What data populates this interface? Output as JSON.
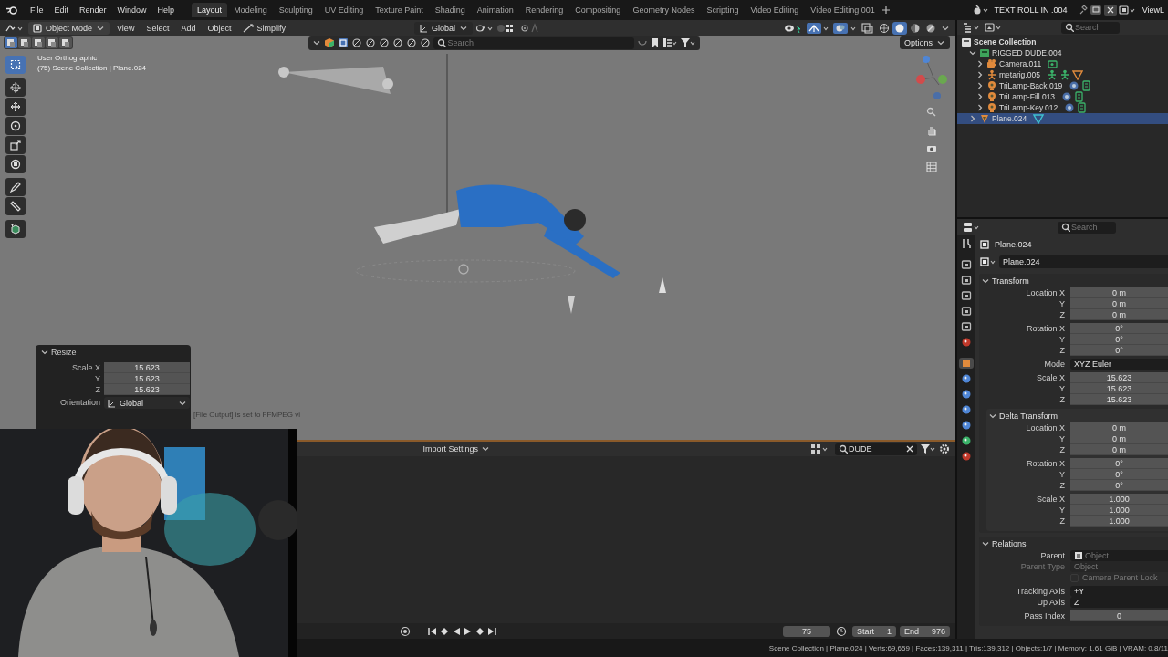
{
  "topbar": {
    "menus": [
      "File",
      "Edit",
      "Render",
      "Window",
      "Help"
    ],
    "workspaces": [
      {
        "label": "Layout",
        "selected": true
      },
      {
        "label": "Modeling",
        "selected": false
      },
      {
        "label": "Sculpting",
        "selected": false
      },
      {
        "label": "UV Editing",
        "selected": false
      },
      {
        "label": "Texture Paint",
        "selected": false
      },
      {
        "label": "Shading",
        "selected": false
      },
      {
        "label": "Animation",
        "selected": false
      },
      {
        "label": "Rendering",
        "selected": false
      },
      {
        "label": "Compositing",
        "selected": false
      },
      {
        "label": "Geometry Nodes",
        "selected": false
      },
      {
        "label": "Scripting",
        "selected": false
      },
      {
        "label": "Video Editing",
        "selected": false
      },
      {
        "label": "Video Editing.001",
        "selected": false
      }
    ],
    "scene": "TEXT ROLL IN .004",
    "view_layer": "ViewL"
  },
  "viewport": {
    "mode": "Object Mode",
    "menus": [
      "View",
      "Select",
      "Add",
      "Object"
    ],
    "simplify": "Simplify",
    "orientation": "Global",
    "search": {
      "placeholder": "Search"
    },
    "options": "Options",
    "select_modes": [
      {
        "selected": true
      },
      {
        "selected": false
      },
      {
        "selected": false
      },
      {
        "selected": false
      },
      {
        "selected": false
      }
    ],
    "shading": [
      {
        "selected": false
      },
      {
        "selected": true
      },
      {
        "selected": false
      },
      {
        "selected": false
      }
    ],
    "view_name": "User Orthographic",
    "view_info": "(75) Scene Collection | Plane.024",
    "tools": [
      {
        "selected": true
      },
      {
        "selected": false
      },
      {
        "selected": false
      },
      {
        "selected": false
      },
      {
        "selected": false
      },
      {
        "selected": false
      },
      {
        "selected": false
      },
      {
        "selected": false
      },
      {
        "selected": false
      }
    ],
    "info": "[File Output] is set to FFMPEG vi",
    "resize": {
      "title": "Resize",
      "expanded": true,
      "rows": [
        {
          "label": "Scale X",
          "value": "15.623"
        },
        {
          "label": "Y",
          "value": "15.623"
        },
        {
          "label": "Z",
          "value": "15.623"
        }
      ],
      "orientation_label": "Orientation",
      "orientation": "Global"
    }
  },
  "asset_browser": {
    "import_settings": "Import Settings",
    "filter": {
      "value": "DUDE"
    }
  },
  "timeline": {
    "frame": "75",
    "start_label": "Start",
    "start": "1",
    "end_label": "End",
    "end": "976"
  },
  "outliner": {
    "search": {
      "placeholder": "Search"
    },
    "tree": [
      {
        "label": "Scene Collection",
        "kind": "scene",
        "selected": false,
        "children": [
          {
            "label": "RIGGED DUDE.004",
            "kind": "collection",
            "expanded": true,
            "selected": false,
            "children": [
              {
                "label": "Camera.011",
                "kind": "camera",
                "expanded": false,
                "selected": false
              },
              {
                "label": "metarig.005",
                "kind": "armature",
                "expanded": false,
                "selected": false
              },
              {
                "label": "TriLamp-Back.019",
                "kind": "light",
                "expanded": false,
                "selected": false
              },
              {
                "label": "TriLamp-Fill.013",
                "kind": "light",
                "expanded": false,
                "selected": false
              },
              {
                "label": "TriLamp-Key.012",
                "kind": "light",
                "expanded": false,
                "selected": false
              }
            ]
          },
          {
            "label": "Plane.024",
            "kind": "mesh",
            "expanded": false,
            "selected": true
          }
        ]
      }
    ]
  },
  "properties": {
    "search": {
      "placeholder": "Search"
    },
    "tabs": [
      {
        "selected": false
      },
      {
        "selected": false
      },
      {
        "selected": false
      },
      {
        "selected": false
      },
      {
        "selected": false
      },
      {
        "selected": false
      },
      {
        "selected": true
      },
      {
        "selected": false
      },
      {
        "selected": false
      },
      {
        "selected": false
      },
      {
        "selected": false
      },
      {
        "selected": false
      },
      {
        "selected": false
      }
    ],
    "object": "Plane.024",
    "name": "Plane.024",
    "sections": [
      {
        "title": "Transform",
        "expanded": true,
        "groups": [
          [
            {
              "kind": "number",
              "label": "Location X",
              "value": "0 m",
              "disabled": false
            },
            {
              "kind": "number",
              "label": "Y",
              "value": "0 m",
              "disabled": false
            },
            {
              "kind": "number",
              "label": "Z",
              "value": "0 m",
              "disabled": false
            }
          ],
          [
            {
              "kind": "number",
              "label": "Rotation X",
              "value": "0°",
              "disabled": false
            },
            {
              "kind": "number",
              "label": "Y",
              "value": "0°",
              "disabled": false
            },
            {
              "kind": "number",
              "label": "Z",
              "value": "0°",
              "disabled": false
            }
          ],
          [
            {
              "kind": "dropdown",
              "label": "Mode",
              "value": "XYZ Euler",
              "disabled": false
            }
          ],
          [
            {
              "kind": "number",
              "label": "Scale X",
              "value": "15.623",
              "disabled": false
            },
            {
              "kind": "number",
              "label": "Y",
              "value": "15.623",
              "disabled": false
            },
            {
              "kind": "number",
              "label": "Z",
              "value": "15.623",
              "disabled": false
            }
          ]
        ],
        "children": [
          {
            "title": "Delta Transform",
            "expanded": true,
            "groups": [
              [
                {
                  "kind": "number",
                  "label": "Location X",
                  "value": "0 m",
                  "disabled": false
                },
                {
                  "kind": "number",
                  "label": "Y",
                  "value": "0 m",
                  "disabled": false
                },
                {
                  "kind": "number",
                  "label": "Z",
                  "value": "0 m",
                  "disabled": false
                }
              ],
              [
                {
                  "kind": "number",
                  "label": "Rotation X",
                  "value": "0°",
                  "disabled": false
                },
                {
                  "kind": "number",
                  "label": "Y",
                  "value": "0°",
                  "disabled": false
                },
                {
                  "kind": "number",
                  "label": "Z",
                  "value": "0°",
                  "disabled": false
                }
              ],
              [
                {
                  "kind": "number",
                  "label": "Scale X",
                  "value": "1.000",
                  "disabled": false
                },
                {
                  "kind": "number",
                  "label": "Y",
                  "value": "1.000",
                  "disabled": false
                },
                {
                  "kind": "number",
                  "label": "Z",
                  "value": "1.000",
                  "disabled": false
                }
              ]
            ]
          }
        ]
      },
      {
        "title": "Relations",
        "expanded": true,
        "groups": [
          [
            {
              "kind": "object",
              "label": "Parent",
              "placeholder": "Object",
              "disabled": false
            },
            {
              "kind": "dropdown",
              "label": "Parent Type",
              "value": "Object",
              "disabled": true
            },
            {
              "kind": "checkbox",
              "label": "Camera Parent Lock",
              "checked": false,
              "disabled": true
            }
          ],
          [
            {
              "kind": "dropdown",
              "label": "Tracking Axis",
              "value": "+Y",
              "disabled": false
            },
            {
              "kind": "dropdown",
              "label": "Up Axis",
              "value": "Z",
              "disabled": false
            }
          ],
          [
            {
              "kind": "number",
              "label": "Pass Index",
              "value": "0",
              "disabled": false
            }
          ]
        ]
      }
    ]
  },
  "status_bar": "Scene Collection | Plane.024 | Verts:69,659 | Faces:139,311 | Tris:139,312 | Objects:1/7 | Memory: 1.61 GiB | VRAM: 0.8/11"
}
